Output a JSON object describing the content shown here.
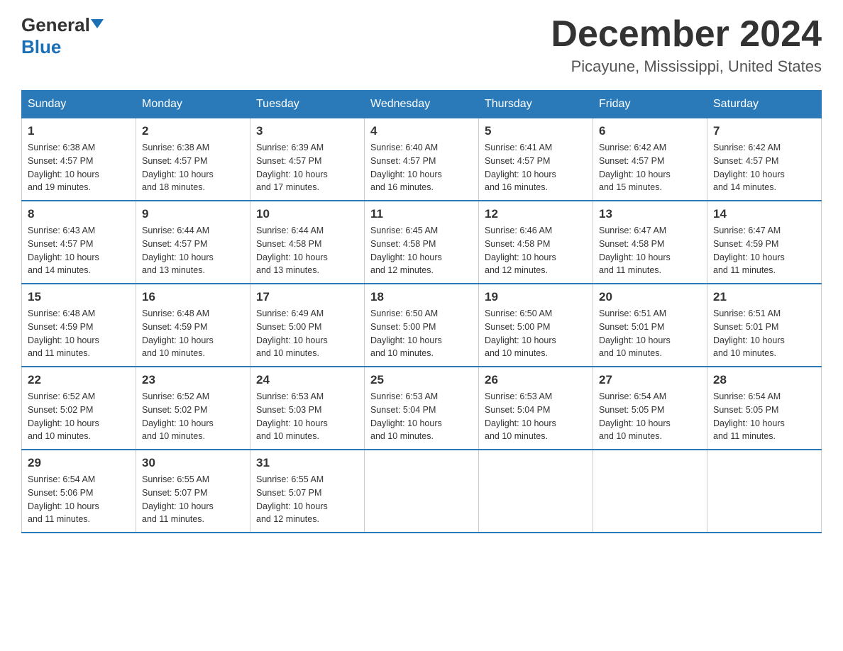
{
  "header": {
    "logo_general": "General",
    "logo_blue": "Blue",
    "month_title": "December 2024",
    "location": "Picayune, Mississippi, United States"
  },
  "weekdays": [
    "Sunday",
    "Monday",
    "Tuesday",
    "Wednesday",
    "Thursday",
    "Friday",
    "Saturday"
  ],
  "weeks": [
    [
      {
        "day": "1",
        "sunrise": "6:38 AM",
        "sunset": "4:57 PM",
        "daylight": "10 hours and 19 minutes."
      },
      {
        "day": "2",
        "sunrise": "6:38 AM",
        "sunset": "4:57 PM",
        "daylight": "10 hours and 18 minutes."
      },
      {
        "day": "3",
        "sunrise": "6:39 AM",
        "sunset": "4:57 PM",
        "daylight": "10 hours and 17 minutes."
      },
      {
        "day": "4",
        "sunrise": "6:40 AM",
        "sunset": "4:57 PM",
        "daylight": "10 hours and 16 minutes."
      },
      {
        "day": "5",
        "sunrise": "6:41 AM",
        "sunset": "4:57 PM",
        "daylight": "10 hours and 16 minutes."
      },
      {
        "day": "6",
        "sunrise": "6:42 AM",
        "sunset": "4:57 PM",
        "daylight": "10 hours and 15 minutes."
      },
      {
        "day": "7",
        "sunrise": "6:42 AM",
        "sunset": "4:57 PM",
        "daylight": "10 hours and 14 minutes."
      }
    ],
    [
      {
        "day": "8",
        "sunrise": "6:43 AM",
        "sunset": "4:57 PM",
        "daylight": "10 hours and 14 minutes."
      },
      {
        "day": "9",
        "sunrise": "6:44 AM",
        "sunset": "4:57 PM",
        "daylight": "10 hours and 13 minutes."
      },
      {
        "day": "10",
        "sunrise": "6:44 AM",
        "sunset": "4:58 PM",
        "daylight": "10 hours and 13 minutes."
      },
      {
        "day": "11",
        "sunrise": "6:45 AM",
        "sunset": "4:58 PM",
        "daylight": "10 hours and 12 minutes."
      },
      {
        "day": "12",
        "sunrise": "6:46 AM",
        "sunset": "4:58 PM",
        "daylight": "10 hours and 12 minutes."
      },
      {
        "day": "13",
        "sunrise": "6:47 AM",
        "sunset": "4:58 PM",
        "daylight": "10 hours and 11 minutes."
      },
      {
        "day": "14",
        "sunrise": "6:47 AM",
        "sunset": "4:59 PM",
        "daylight": "10 hours and 11 minutes."
      }
    ],
    [
      {
        "day": "15",
        "sunrise": "6:48 AM",
        "sunset": "4:59 PM",
        "daylight": "10 hours and 11 minutes."
      },
      {
        "day": "16",
        "sunrise": "6:48 AM",
        "sunset": "4:59 PM",
        "daylight": "10 hours and 10 minutes."
      },
      {
        "day": "17",
        "sunrise": "6:49 AM",
        "sunset": "5:00 PM",
        "daylight": "10 hours and 10 minutes."
      },
      {
        "day": "18",
        "sunrise": "6:50 AM",
        "sunset": "5:00 PM",
        "daylight": "10 hours and 10 minutes."
      },
      {
        "day": "19",
        "sunrise": "6:50 AM",
        "sunset": "5:00 PM",
        "daylight": "10 hours and 10 minutes."
      },
      {
        "day": "20",
        "sunrise": "6:51 AM",
        "sunset": "5:01 PM",
        "daylight": "10 hours and 10 minutes."
      },
      {
        "day": "21",
        "sunrise": "6:51 AM",
        "sunset": "5:01 PM",
        "daylight": "10 hours and 10 minutes."
      }
    ],
    [
      {
        "day": "22",
        "sunrise": "6:52 AM",
        "sunset": "5:02 PM",
        "daylight": "10 hours and 10 minutes."
      },
      {
        "day": "23",
        "sunrise": "6:52 AM",
        "sunset": "5:02 PM",
        "daylight": "10 hours and 10 minutes."
      },
      {
        "day": "24",
        "sunrise": "6:53 AM",
        "sunset": "5:03 PM",
        "daylight": "10 hours and 10 minutes."
      },
      {
        "day": "25",
        "sunrise": "6:53 AM",
        "sunset": "5:04 PM",
        "daylight": "10 hours and 10 minutes."
      },
      {
        "day": "26",
        "sunrise": "6:53 AM",
        "sunset": "5:04 PM",
        "daylight": "10 hours and 10 minutes."
      },
      {
        "day": "27",
        "sunrise": "6:54 AM",
        "sunset": "5:05 PM",
        "daylight": "10 hours and 10 minutes."
      },
      {
        "day": "28",
        "sunrise": "6:54 AM",
        "sunset": "5:05 PM",
        "daylight": "10 hours and 11 minutes."
      }
    ],
    [
      {
        "day": "29",
        "sunrise": "6:54 AM",
        "sunset": "5:06 PM",
        "daylight": "10 hours and 11 minutes."
      },
      {
        "day": "30",
        "sunrise": "6:55 AM",
        "sunset": "5:07 PM",
        "daylight": "10 hours and 11 minutes."
      },
      {
        "day": "31",
        "sunrise": "6:55 AM",
        "sunset": "5:07 PM",
        "daylight": "10 hours and 12 minutes."
      },
      null,
      null,
      null,
      null
    ]
  ],
  "labels": {
    "sunrise": "Sunrise:",
    "sunset": "Sunset:",
    "daylight": "Daylight:"
  }
}
